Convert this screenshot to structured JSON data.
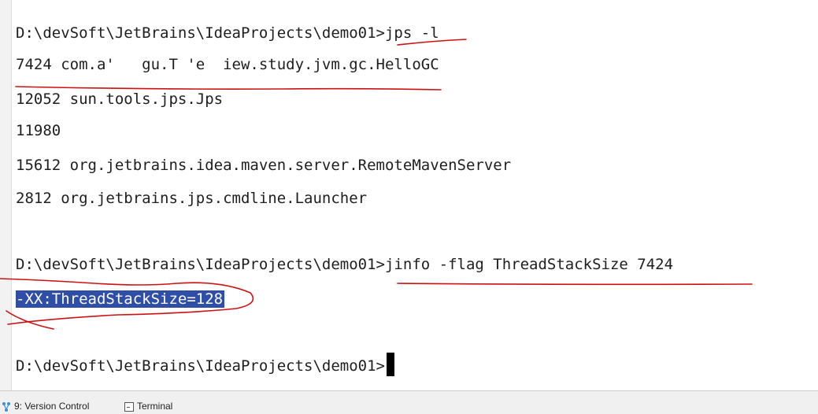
{
  "terminal": {
    "lines": [
      "D:\\devSoft\\JetBrains\\IdeaProjects\\demo01>jps -l",
      "7424 com.a'   gu.T 'e  iew.study.jvm.gc.HelloGC",
      "12052 sun.tools.jps.Jps",
      "11980",
      "15612 org.jetbrains.idea.maven.server.RemoteMavenServer",
      "2812 org.jetbrains.jps.cmdline.Launcher",
      "D:\\devSoft\\JetBrains\\IdeaProjects\\demo01>jinfo -flag ThreadStackSize 7424",
      "-XX:ThreadStackSize=128",
      "D:\\devSoft\\JetBrains\\IdeaProjects\\demo01>"
    ]
  },
  "statusbar": {
    "version_control_label": "9: Version Control",
    "terminal_label": "Terminal"
  },
  "colors": {
    "selection": "#2f4ea6",
    "annotation": "#cc1111",
    "vcs_icon": "#3d8fd1"
  },
  "icons": {
    "version_control": "vcs-branch-icon",
    "terminal": "terminal-icon"
  }
}
